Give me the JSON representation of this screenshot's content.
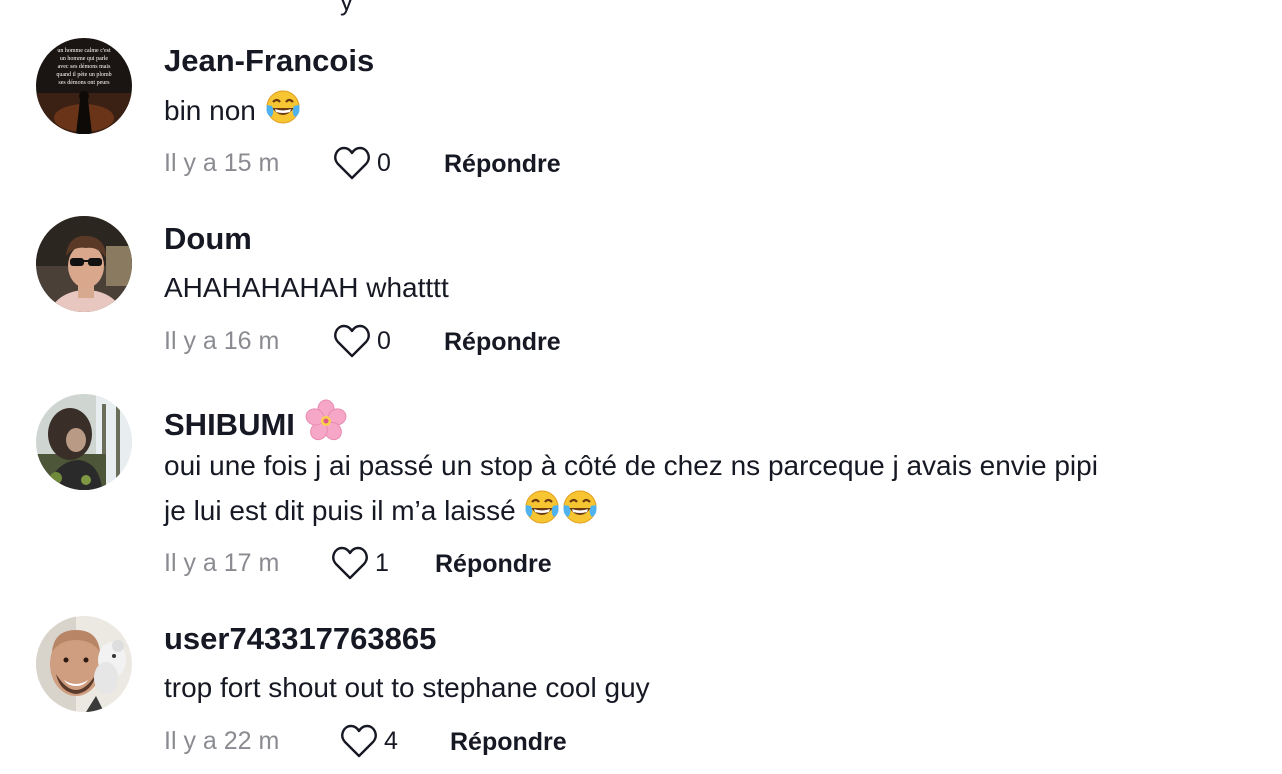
{
  "top_cut_text": "y",
  "comments": [
    {
      "username": "Jean-Francois",
      "text": "bin non",
      "emoji": "tears-of-joy",
      "time": "Il y a 15 m",
      "likes": "0",
      "reply": "Répondre",
      "avatar_text": "un homme calme c'est un homme qui parle avec ses démons mais quand il pète un plomb ses démons ont peurs"
    },
    {
      "username": "Doum",
      "text": "AHAHAHAHAH whatttt",
      "time": "Il y a 16 m",
      "likes": "0",
      "reply": "Répondre"
    },
    {
      "username": "SHIBUMI",
      "name_emoji": "cherry-blossom",
      "text_line1": "oui une fois j ai passé un stop à côté de chez ns parceque j avais envie pipi",
      "text_line2": "je lui est dit puis il m’a laissé",
      "emoji": "tears-of-joy x2",
      "time": "Il y a 17 m",
      "likes": "1",
      "reply": "Répondre"
    },
    {
      "username": "user743317763865",
      "text": "trop fort shout out to stephane cool guy",
      "time": "Il y a 22 m",
      "likes": "4",
      "reply": "Répondre"
    }
  ],
  "colors": {
    "primary_text": "#161823",
    "secondary_text": "#8a8b91",
    "background": "#ffffff"
  },
  "icons": [
    "heart-outline-icon",
    "tears-of-joy-emoji",
    "cherry-blossom-emoji"
  ]
}
